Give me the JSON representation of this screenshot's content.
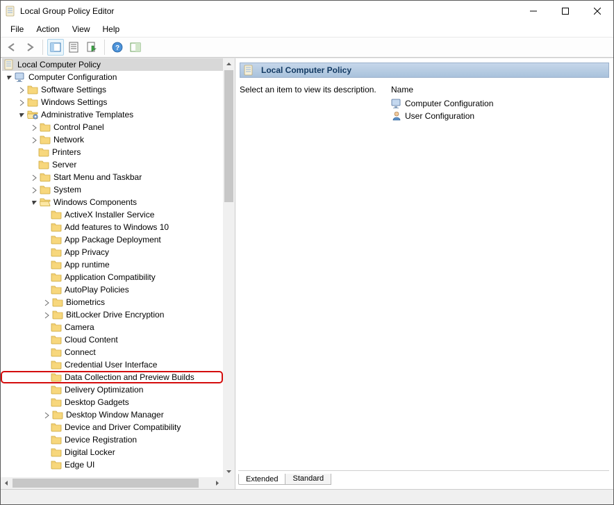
{
  "window": {
    "title": "Local Group Policy Editor"
  },
  "menus": {
    "file": "File",
    "action": "Action",
    "view": "View",
    "help": "Help"
  },
  "tree": {
    "root": "Local Computer Policy",
    "cfg": "Computer Configuration",
    "software": "Software Settings",
    "windows_settings": "Windows Settings",
    "adm_templates": "Administrative Templates",
    "control_panel": "Control Panel",
    "network": "Network",
    "printers": "Printers",
    "server": "Server",
    "start_menu": "Start Menu and Taskbar",
    "system": "System",
    "windows_components": "Windows Components",
    "wc": {
      "activex": "ActiveX Installer Service",
      "add_features": "Add features to Windows 10",
      "app_pkg": "App Package Deployment",
      "app_privacy": "App Privacy",
      "app_runtime": "App runtime",
      "app_compat": "Application Compatibility",
      "autoplay": "AutoPlay Policies",
      "biometrics": "Biometrics",
      "bitlocker": "BitLocker Drive Encryption",
      "camera": "Camera",
      "cloud": "Cloud Content",
      "connect": "Connect",
      "cred_ui": "Credential User Interface",
      "data_collection": "Data Collection and Preview Builds",
      "delivery_opt": "Delivery Optimization",
      "desktop_gadgets": "Desktop Gadgets",
      "desktop_wm": "Desktop Window Manager",
      "device_driver": "Device and Driver Compatibility",
      "device_reg": "Device Registration",
      "digital_locker": "Digital Locker",
      "edge_ui": "Edge UI"
    }
  },
  "details": {
    "header": "Local Computer Policy",
    "description": "Select an item to view its description.",
    "col_name": "Name",
    "items": {
      "computer_cfg": "Computer Configuration",
      "user_cfg": "User Configuration"
    }
  },
  "tabs": {
    "extended": "Extended",
    "standard": "Standard"
  }
}
